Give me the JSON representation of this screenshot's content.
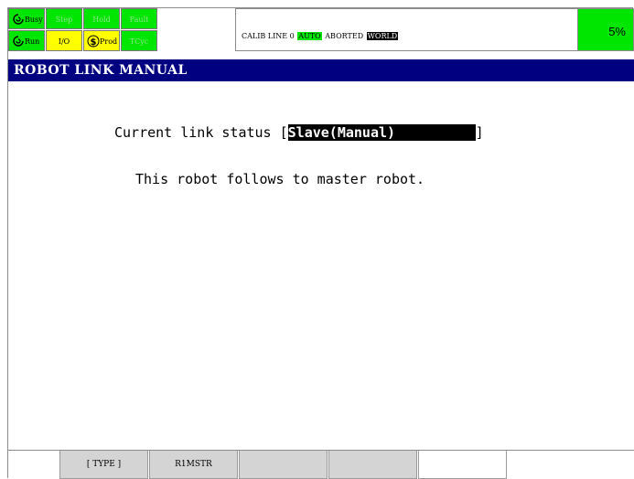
{
  "indicators": {
    "busy": "Busy",
    "step": "Step",
    "hold": "Hold",
    "fault": "Fault",
    "run": "Run",
    "io": "I/O",
    "prod": "Prod",
    "tcyc": "TCyc"
  },
  "prompt": {
    "program": "CALIB LINE 0",
    "mode": "AUTO",
    "state": "ABORTED",
    "frame": "WORLD"
  },
  "override": "5%",
  "title": "ROBOT LINK MANUAL",
  "content": {
    "status_prefix": "Current link status [",
    "status_value": "Slave(Manual)",
    "status_suffix": "]",
    "message": "This robot follows to master robot."
  },
  "function_keys": [
    "",
    "[ TYPE ]",
    "R1MSTR",
    "",
    "",
    ""
  ],
  "colors": {
    "indicator_green": "#00e600",
    "indicator_yellow": "#ffff00",
    "title_bar": "#000080",
    "function_key": "#d4d4d4"
  }
}
